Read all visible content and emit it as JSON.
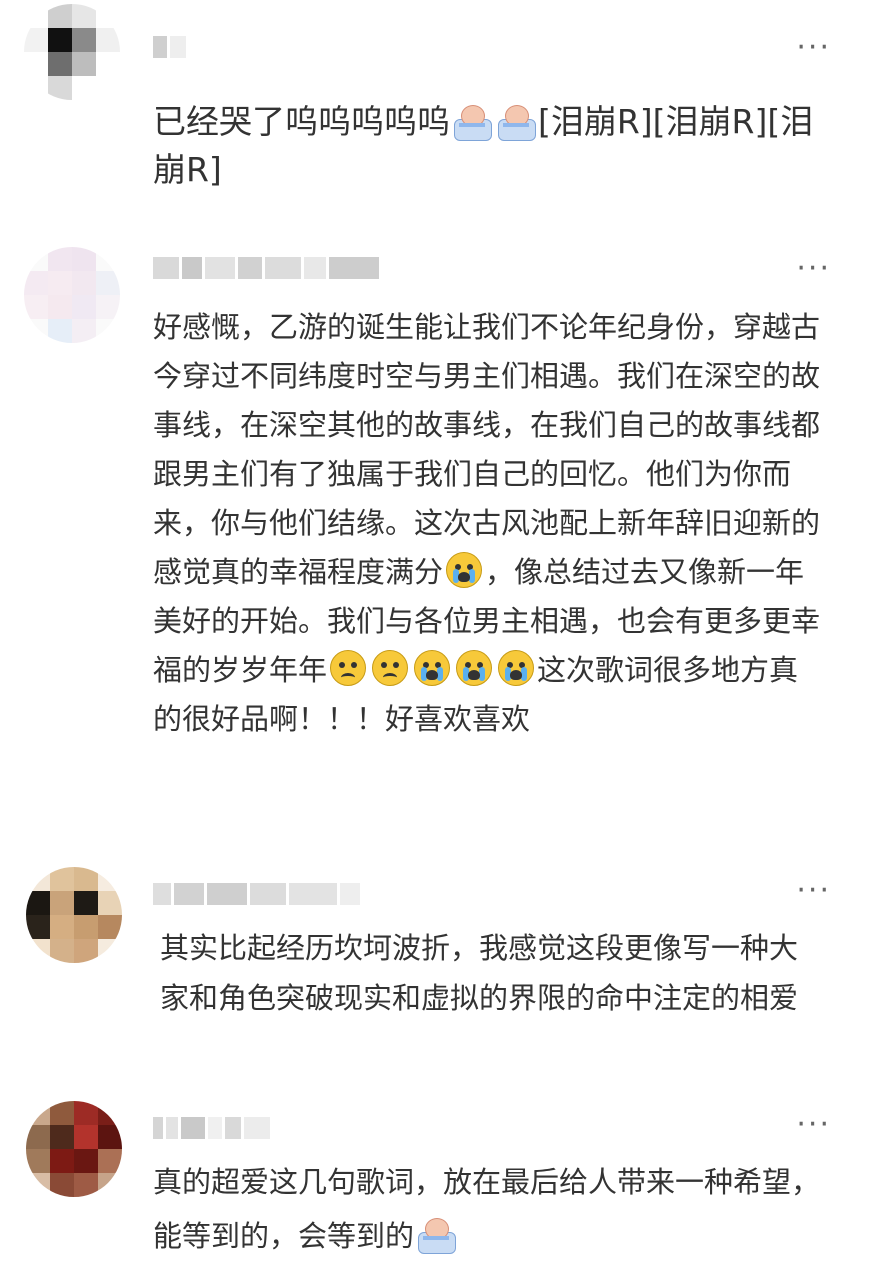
{
  "menu_glyph": "···",
  "comments": [
    {
      "text_parts": [
        "已经哭了呜呜呜呜呜",
        "",
        "",
        "[泪崩R][泪崩R][泪崩R]"
      ]
    },
    {
      "text_parts": [
        "好感慨，乙游的诞生能让我们不论年纪身份，穿越古今穿过不同纬度时空与男主们相遇。我们在深空的故事线，在深空其他的故事线，在我们自己的故事线都跟男主们有了独属于我们自己的回忆。他们为你而来，你与他们结缘。这次古风池配上新年辞旧迎新的感觉真的幸福程度满分",
        "，像总结过去又像新一年美好的开始。我们与各位男主相遇，也会有更多更幸福的岁岁年年",
        "这次歌词很多地方真的很好品啊！！！好喜欢喜欢"
      ]
    },
    {
      "text_parts": [
        "其实比起经历坎坷波折，我感觉这段更像写一种大家和角色突破现实和虚拟的界限的命中注定的相爱"
      ]
    },
    {
      "text_parts": [
        "真的超爱这几句歌词，放在最后给人带来一种希望，能等到的，会等到的"
      ]
    }
  ],
  "colors": {
    "text": "#333333",
    "menu": "#666666",
    "emoji_yellow": "#f7c93a",
    "tear_blue": "#5ab0ef"
  },
  "icons": [
    "crying-sticker-icon",
    "crying-face-icon",
    "sad-face-icon",
    "more-icon"
  ]
}
